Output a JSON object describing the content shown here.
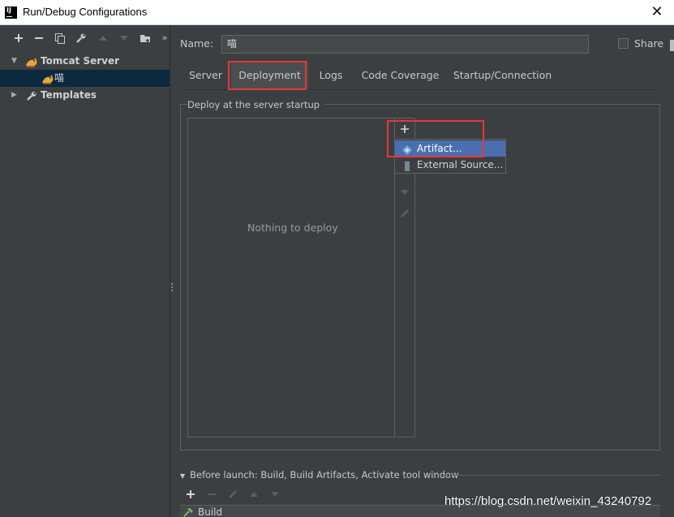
{
  "window": {
    "title": "Run/Debug Configurations",
    "close_glyph": "✕",
    "app_icon_text": "IJ"
  },
  "left_toolbar": {
    "icons": [
      "add-icon",
      "remove-icon",
      "copy-icon",
      "wrench-icon",
      "move-up-icon",
      "move-down-icon",
      "folder-add-icon",
      "more-icon"
    ]
  },
  "tree": {
    "tomcat_server": "Tomcat Server",
    "config_item": "喵",
    "templates": "Templates"
  },
  "name": {
    "label": "Name:",
    "value": "喵"
  },
  "share": {
    "label": "Share",
    "checked": false
  },
  "tabs": [
    {
      "label": "Server"
    },
    {
      "label": "Deployment"
    },
    {
      "label": "Logs"
    },
    {
      "label": "Code Coverage"
    },
    {
      "label": "Startup/Connection"
    }
  ],
  "active_tab": "Deployment",
  "deploy": {
    "group_title": "Deploy at the server startup",
    "empty_text": "Nothing to deploy"
  },
  "popup": {
    "items": [
      {
        "label": "Artifact...",
        "icon": "artifact-icon",
        "selected": true
      },
      {
        "label": "External Source...",
        "icon": "external-source-icon",
        "selected": false
      }
    ]
  },
  "before_launch": {
    "label": "Before launch: Build, Build Artifacts, Activate tool window",
    "build_item": "Build"
  },
  "watermark": "https://blog.csdn.net/weixin_43240792",
  "colors": {
    "background": "#3c3f41",
    "selection": "#0d293e",
    "popup_selection": "#4b6eaf",
    "highlight": "#e8363a"
  }
}
